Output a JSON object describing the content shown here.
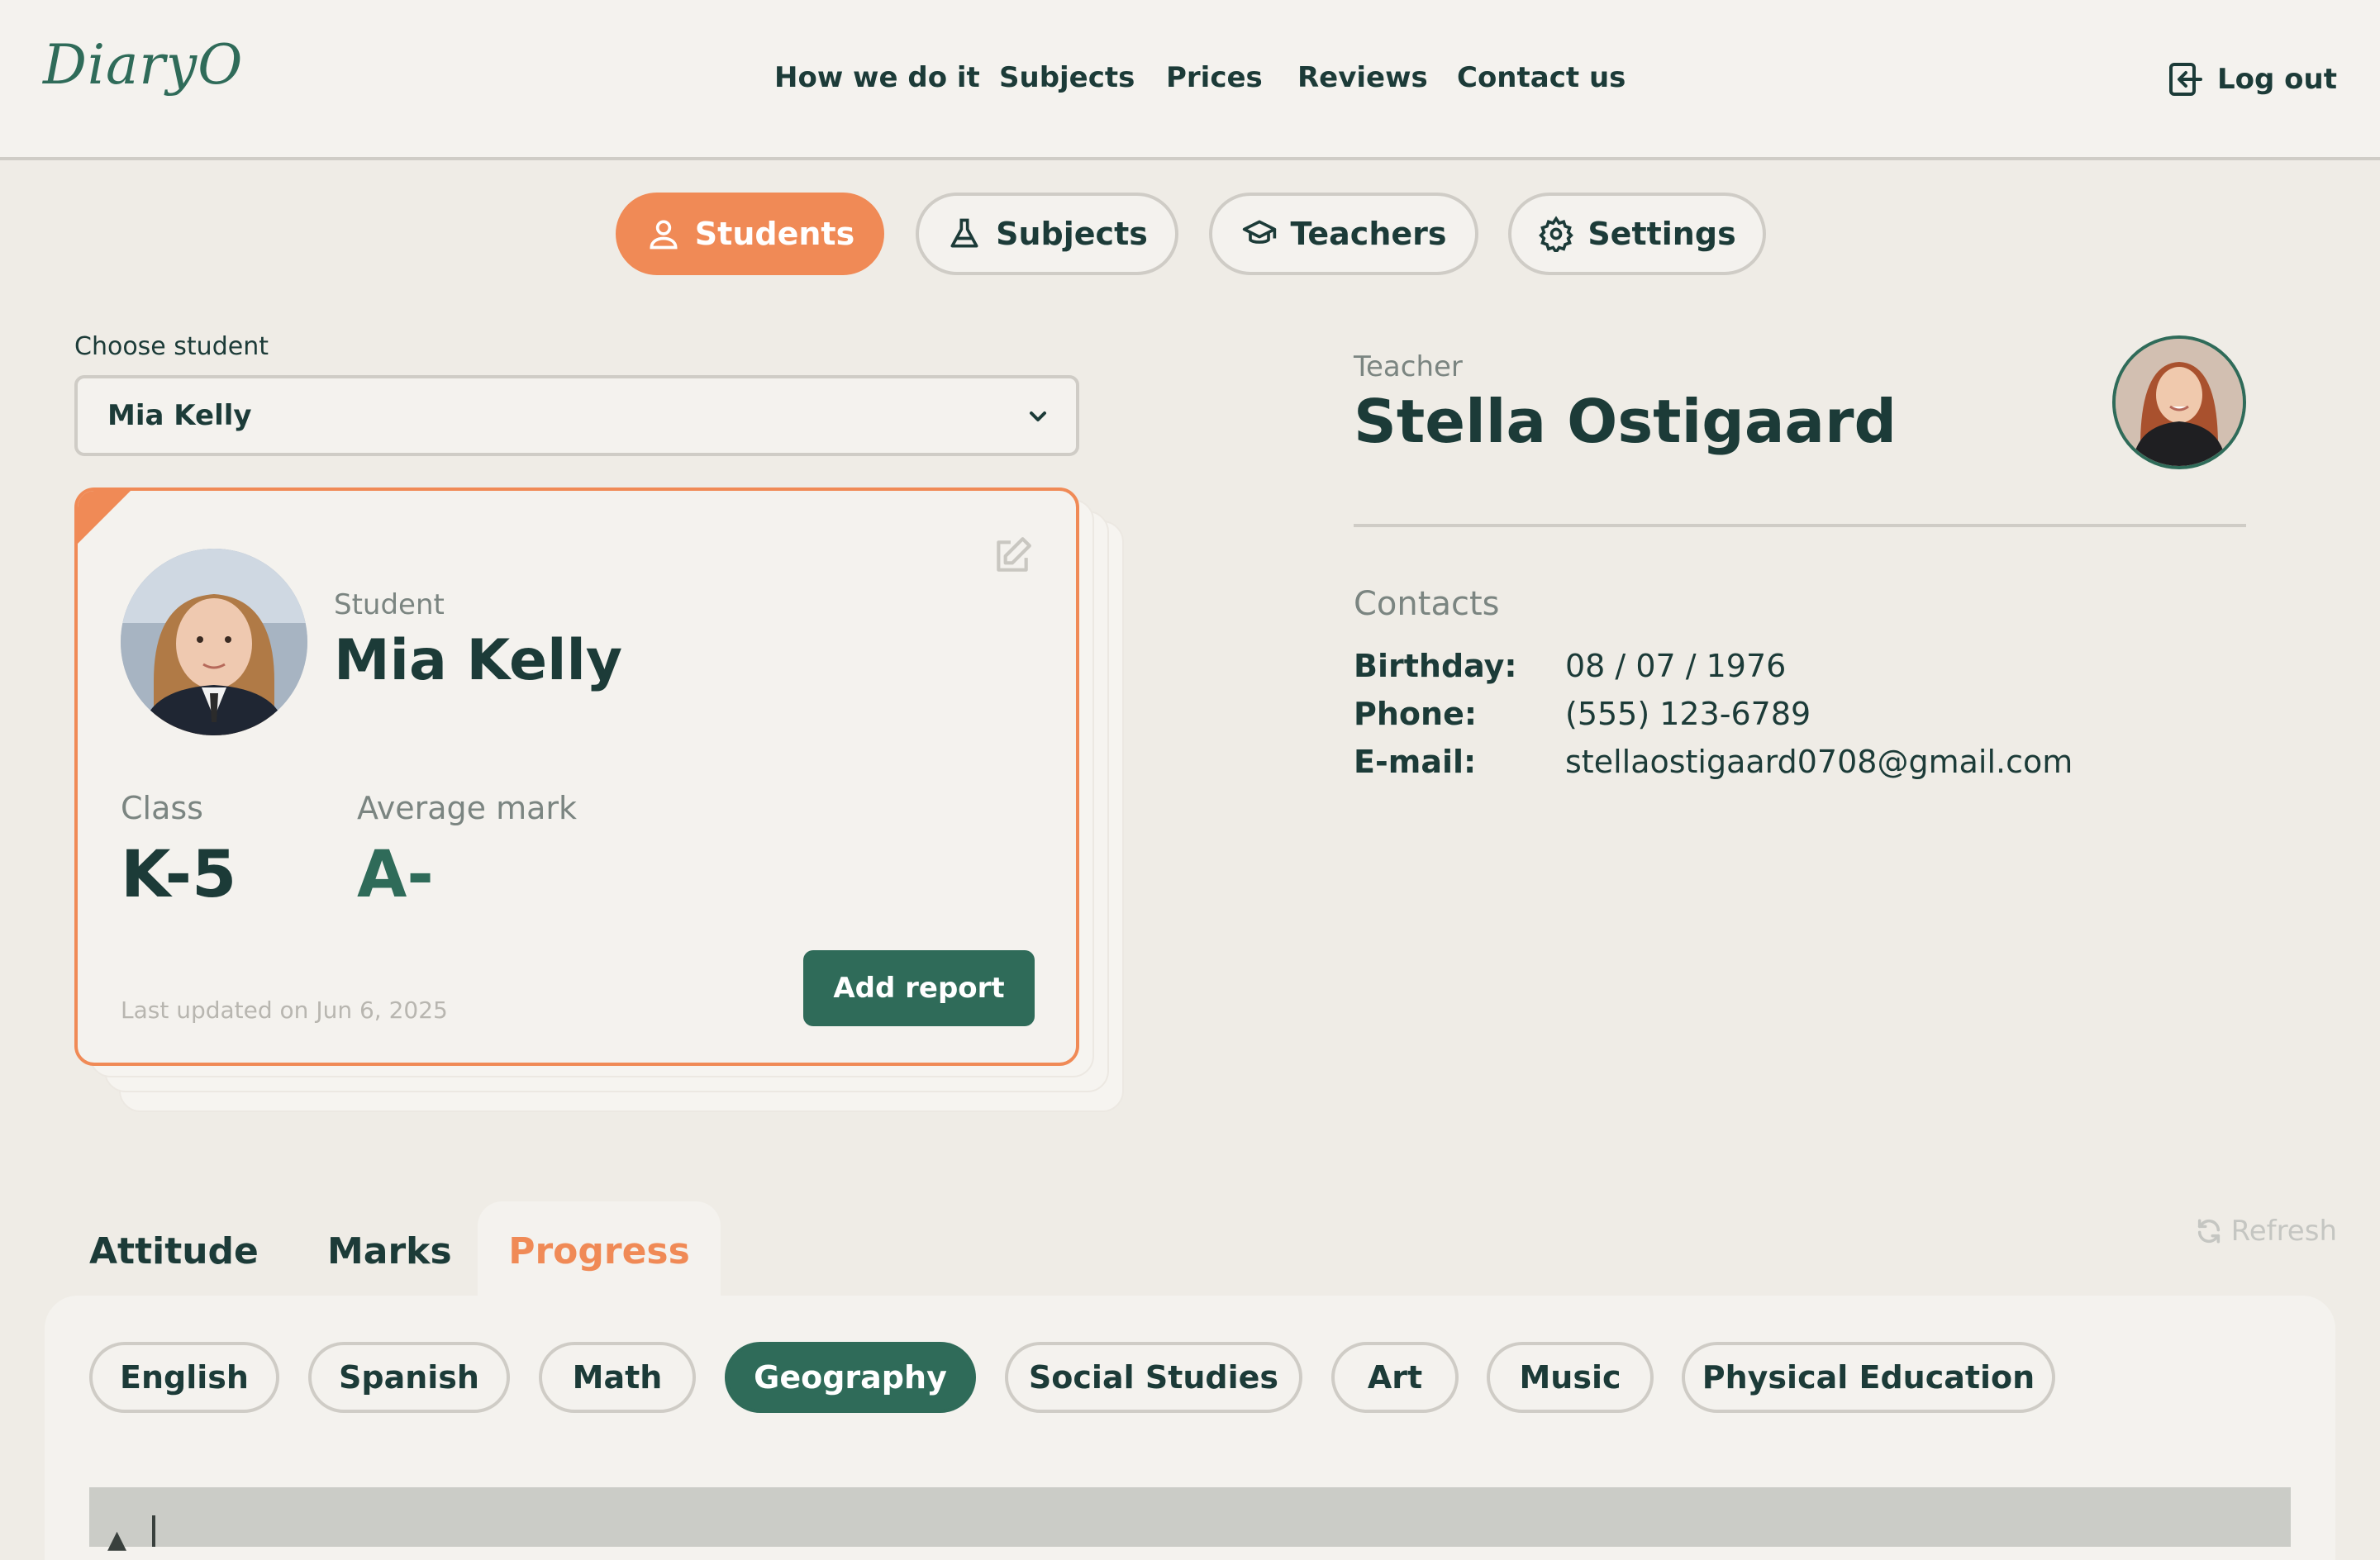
{
  "header": {
    "logo": "DiaryO",
    "nav": [
      "How we do it",
      "Subjects",
      "Prices",
      "Reviews",
      "Contact us"
    ],
    "logout_label": "Log out"
  },
  "top_tabs": [
    {
      "label": "Students",
      "icon": "user-icon",
      "active": true
    },
    {
      "label": "Subjects",
      "icon": "flask-icon",
      "active": false
    },
    {
      "label": "Teachers",
      "icon": "graduation-cap-icon",
      "active": false
    },
    {
      "label": "Settings",
      "icon": "gear-icon",
      "active": false
    }
  ],
  "student_select": {
    "label": "Choose student",
    "value": "Mia Kelly"
  },
  "student_card": {
    "role": "Student",
    "name": "Mia Kelly",
    "class_label": "Class",
    "class_value": "K-5",
    "avg_label": "Average mark",
    "avg_value": "A-",
    "updated": "Last updated on Jun 6, 2025",
    "add_report": "Add report"
  },
  "teacher": {
    "role": "Teacher",
    "name": "Stella Ostigaard",
    "contacts_title": "Contacts",
    "contacts": [
      {
        "key": "Birthday:",
        "value": "08 / 07 / 1976"
      },
      {
        "key": "Phone:",
        "value": "(555) 123-6789"
      },
      {
        "key": "E-mail:",
        "value": "stellaostigaard0708@gmail.com"
      }
    ]
  },
  "bottom_tabs": [
    {
      "label": "Attitude",
      "active": false
    },
    {
      "label": "Marks",
      "active": false
    },
    {
      "label": "Progress",
      "active": true
    }
  ],
  "refresh_label": "Refresh",
  "subjects": [
    {
      "label": "English",
      "active": false
    },
    {
      "label": "Spanish",
      "active": false
    },
    {
      "label": "Math",
      "active": false
    },
    {
      "label": "Geography",
      "active": true
    },
    {
      "label": "Social Studies",
      "active": false
    },
    {
      "label": "Art",
      "active": false
    },
    {
      "label": "Music",
      "active": false
    },
    {
      "label": "Physical Education",
      "active": false
    }
  ],
  "colors": {
    "accent": "#f08a56",
    "primary": "#2f6b59",
    "text": "#1c3b38",
    "background": "#efece6"
  }
}
